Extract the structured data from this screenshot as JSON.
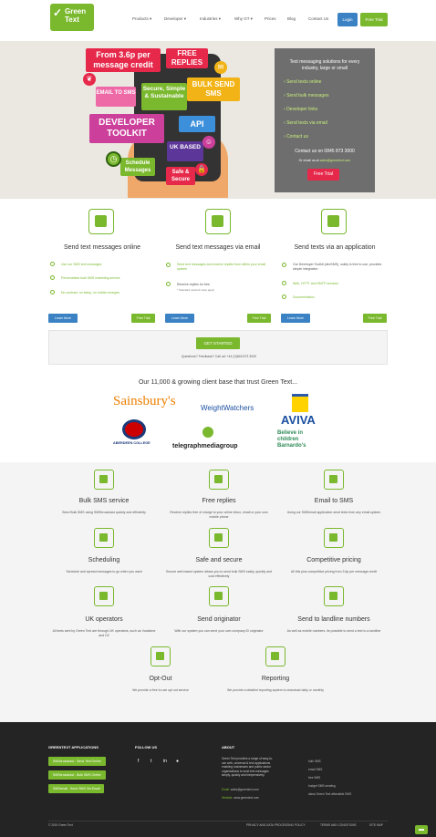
{
  "header": {
    "logo_text": "Green Text",
    "nav": [
      "Products ▾",
      "Developer ▾",
      "Industries ▾",
      "Why GT ▾",
      "Prices",
      "Blog",
      "Contact Us"
    ],
    "login": "Login",
    "free_trial": "Free Trial"
  },
  "hero": {
    "tags": [
      "From 3.6p per message credit",
      "FREE REPLIES",
      "EMAIL TO SMS",
      "Secure, Simple & Sustainable",
      "BULK SEND SMS",
      "DEVELOPER TOOLKIT",
      "API",
      "UK BASED",
      "Schedule Messages",
      "Safe & Secure"
    ],
    "panel_title": "Text messaging solutions for every industry, large or small",
    "links": [
      "Send texts online",
      "Send bulk messages",
      "Developer links",
      "Send texts via email",
      "Contact us"
    ],
    "contact": "Contact us on 0845 873 3000",
    "email_line": "Or email us at",
    "email": "sales@greentext.com",
    "cta": "Free Trial"
  },
  "features": [
    {
      "title": "Send text messages online",
      "bullets": [
        "Use our SMS text messages",
        "Personalised bulk SMS marketing service",
        "No contract, no setup, no hidden charges"
      ],
      "learn": "Learn More",
      "trial": "Free Trial"
    },
    {
      "title": "Send text messages via email",
      "bullets": [
        "Send text messages and receive replies from within your email system",
        "Receive replies for free"
      ],
      "note": "* Standard network rates apply",
      "learn": "Learn More",
      "trial": "Free Trial"
    },
    {
      "title": "Send texts via an application",
      "bullets": [
        "Our Developer Toolkit (devSMS), solely is free to use, provides simple integration",
        "Web, HTTP, and SMTP services",
        "Documentation"
      ],
      "learn": "Learn More",
      "trial": "Free Trial"
    }
  ],
  "started": {
    "button": "GET STARTED",
    "line": "Questions? Feedback? Call us! +44 (0)845 873 3000"
  },
  "clients": {
    "title": "Our 11,000 & growing client base that trust Green Text...",
    "logos": [
      "Sainsbury's",
      "WeightWatchers",
      "AVIVA",
      "ABERDEEN COLLEGE",
      "telegraphmediagroup",
      "Believe in children Barnardo's"
    ]
  },
  "services": [
    {
      "title": "Bulk SMS service",
      "desc": "Send Bulk SMS using SMSbroadcast quickly and efficiently"
    },
    {
      "title": "Free replies",
      "desc": "Receive replies free of charge to your online inbox, email or your own mobile phone"
    },
    {
      "title": "Email to SMS",
      "desc": "Using our SMSemail application send texts from any email system"
    },
    {
      "title": "Scheduling",
      "desc": "Schedule and spread messages to go when you want"
    },
    {
      "title": "Safe and secure",
      "desc": "Secure web based system allows you to send bulk SMS easily, quickly and cost effectively"
    },
    {
      "title": "Competitive pricing",
      "desc": "All this plus competitive pricing from 3.6p per message credit"
    },
    {
      "title": "UK operators",
      "desc": "All texts sent by Green Text are through UK operators, such as Vodafone and O2"
    },
    {
      "title": "Send originator",
      "desc": "With our system you can send your own company ID originator"
    },
    {
      "title": "Send to landline numbers",
      "desc": "As well as mobile numbers, its possible to send a text to a landline"
    },
    {
      "title": "Opt-Out",
      "desc": "We provide a free to use opt out service"
    },
    {
      "title": "Reporting",
      "desc": "We provide a detailed reporting system to download daily or monthly"
    }
  ],
  "footer": {
    "apps_title": "GREENTEXT APPLICATIONS",
    "apps": [
      "SMSbroadcast - Send Text Online",
      "SMSbroadcast - Bulk SMS Online",
      "SMSemail - Send SMS Via Email"
    ],
    "follow_title": "FOLLOW US",
    "about_title": "ABOUT",
    "about_text": "Green Text provides a range of easy-to-use web, universal & text applications enabling businesses and public sector organisations to send text messages simply, quickly and inexpensively.",
    "email_label": "Email:",
    "email": "sales@greentext.com",
    "web_label": "Website:",
    "web": "www.greentext.com",
    "about_links": [
      "bulk SMS",
      "email SMS",
      "free SMS",
      "budget SMS sending",
      "about Green Text affordable SMS"
    ],
    "copyright": "© 2019 Green Text",
    "bottom_links": [
      "PRIVACY AND DATA PROCESSING POLICY",
      "TERMS AND CONDITIONS",
      "SITE MAP"
    ]
  },
  "colors": {
    "green": "#7ab82e",
    "blue": "#3a82c4",
    "dark": "#242424"
  }
}
